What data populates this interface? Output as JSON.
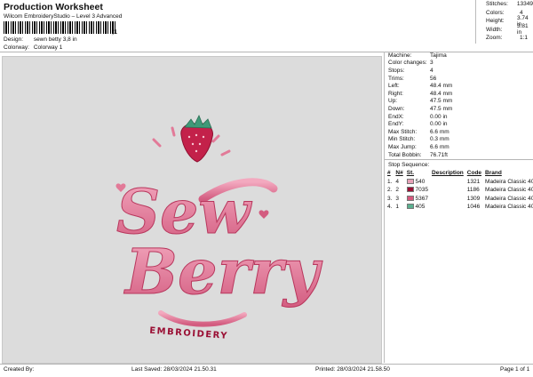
{
  "header": {
    "title": "Production Worksheet",
    "subtitle": "Wilcom EmbroideryStudio – Level 3 Advanced",
    "barcode_suffix": ",1",
    "design_label": "Design:",
    "design_value": "sewn betty 3,8 in",
    "colorway_label": "Colorway:",
    "colorway_value": "Colorway 1"
  },
  "summary": [
    {
      "label": "Stitches:",
      "value": "13349"
    },
    {
      "label": "Colors:",
      "value": "4"
    },
    {
      "label": "Height:",
      "value": "3.74 in"
    },
    {
      "label": "Width:",
      "value": "3.81 in"
    },
    {
      "label": "Zoom:",
      "value": "1:1"
    }
  ],
  "machine_info": [
    {
      "label": "Machine:",
      "value": "Tajima"
    },
    {
      "label": "Color changes:",
      "value": "3"
    },
    {
      "label": "Stops:",
      "value": "4"
    },
    {
      "label": "Trims:",
      "value": "56"
    },
    {
      "label": "Left:",
      "value": "48.4 mm"
    },
    {
      "label": "Right:",
      "value": "48.4 mm"
    },
    {
      "label": "Up:",
      "value": "47.5 mm"
    },
    {
      "label": "Down:",
      "value": "47.5 mm"
    },
    {
      "label": "EndX:",
      "value": "0.00 in"
    },
    {
      "label": "EndY:",
      "value": "0.00 in"
    },
    {
      "label": "Max Stitch:",
      "value": "6.6 mm"
    },
    {
      "label": "Min Stitch:",
      "value": "0.3 mm"
    },
    {
      "label": "Max Jump:",
      "value": "6.6 mm"
    },
    {
      "label": "Total Bobbin:",
      "value": "76.71ft"
    }
  ],
  "stop_sequence": {
    "title": "Stop Sequence:",
    "headers": [
      "#",
      "N#",
      "St.",
      "Description",
      "Code",
      "Brand"
    ],
    "rows": [
      {
        "num": "1.",
        "n": "4",
        "color": "#e6a1b7",
        "st": "540",
        "desc": "",
        "code": "1321",
        "brand": "Madeira Classic 40"
      },
      {
        "num": "2.",
        "n": "2",
        "color": "#9a0f34",
        "st": "7035",
        "desc": "",
        "code": "1186",
        "brand": "Madeira Classic 40"
      },
      {
        "num": "3.",
        "n": "3",
        "color": "#d6587d",
        "st": "5367",
        "desc": "",
        "code": "1309",
        "brand": "Madeira Classic 40"
      },
      {
        "num": "4.",
        "n": "1",
        "color": "#5bb08f",
        "st": "405",
        "desc": "",
        "code": "1046",
        "brand": "Madeira Classic 40"
      }
    ]
  },
  "design": {
    "line1": "Sew",
    "line2": "Berry",
    "line3": "EMBROIDERY"
  },
  "footer": {
    "created_by": "Created By:",
    "last_saved": "Last Saved: 28/03/2024 21.50.31",
    "printed": "Printed: 28/03/2024 21.58.50",
    "page": "Page 1 of 1"
  }
}
